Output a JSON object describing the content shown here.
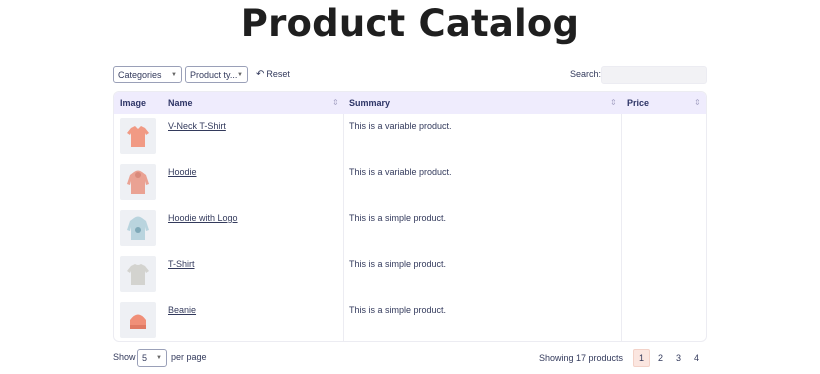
{
  "page": {
    "title": "Product Catalog"
  },
  "filters": {
    "categories": "Categories",
    "product_type": "Product ty...",
    "reset_label": "Reset",
    "search_label": "Search:",
    "search_value": ""
  },
  "table": {
    "columns": [
      "Image",
      "Name",
      "Summary",
      "Price"
    ],
    "rows": [
      {
        "name": "V-Neck T-Shirt",
        "summary": "This is a variable product.",
        "price": "",
        "image": "vneck-tshirt-icon"
      },
      {
        "name": "Hoodie",
        "summary": "This is a variable product.",
        "price": "",
        "image": "hoodie-icon"
      },
      {
        "name": "Hoodie with Logo",
        "summary": "This is a simple product.",
        "price": "",
        "image": "hoodie-logo-icon"
      },
      {
        "name": "T-Shirt",
        "summary": "This is a simple product.",
        "price": "",
        "image": "tshirt-icon"
      },
      {
        "name": "Beanie",
        "summary": "This is a simple product.",
        "price": "",
        "image": "beanie-icon"
      }
    ]
  },
  "pagination": {
    "show_label": "Show",
    "per_page_value": "5",
    "per_page_label": "per page",
    "showing_text": "Showing 17 products",
    "pages": [
      "1",
      "2",
      "3",
      "4"
    ],
    "current_page": "1"
  },
  "colors": {
    "header_bg": "#efecfd",
    "active_page_bg": "#fbe6e0",
    "text": "#333a5c"
  }
}
